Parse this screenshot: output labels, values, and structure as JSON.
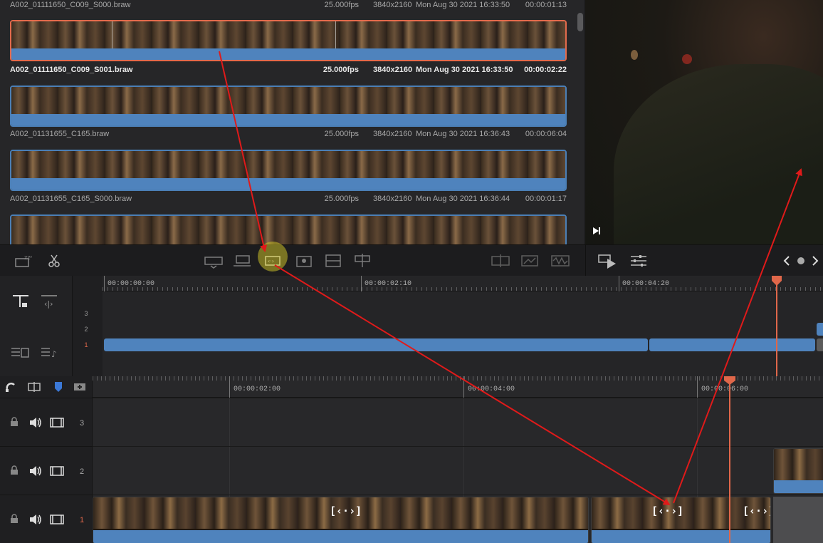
{
  "media_pool": {
    "clips": [
      {
        "name": "A002_01111650_C009_S000.braw",
        "fps": "25.000fps",
        "resolution": "3840x2160",
        "date": "Mon Aug 30 2021 16:33:50",
        "duration": "00:00:01:13"
      },
      {
        "name": "A002_01111650_C009_S001.braw",
        "fps": "25.000fps",
        "resolution": "3840x2160",
        "date": "Mon Aug 30 2021 16:33:50",
        "duration": "00:00:02:22"
      },
      {
        "name": "A002_01131655_C165.braw",
        "fps": "25.000fps",
        "resolution": "3840x2160",
        "date": "Mon Aug 30 2021 16:36:43",
        "duration": "00:00:06:04"
      },
      {
        "name": "A002_01131655_C165_S000.braw",
        "fps": "25.000fps",
        "resolution": "3840x2160",
        "date": "Mon Aug 30 2021 16:36:44",
        "duration": "00:00:01:17"
      }
    ]
  },
  "toolbar": {
    "icons": [
      "bypass-icon",
      "razor-icon",
      "smart-insert-icon",
      "append-icon",
      "ripple-overwrite-icon",
      "close-up-icon",
      "place-on-top-icon",
      "source-overwrite-icon",
      "split-clip-icon",
      "audio-only-icon",
      "video-only-icon",
      "waveform-icon",
      "playback-icon",
      "settings-sliders-icon"
    ]
  },
  "upper_timeline": {
    "ruler": [
      "00:00:00:00",
      "00:00:02:10",
      "00:00:04:20"
    ],
    "tracks": [
      "3",
      "2",
      "1"
    ]
  },
  "lower_timeline": {
    "ruler": [
      "00:00:02:00",
      "00:00:04:00",
      "00:00:06:00"
    ],
    "tracks": [
      "3",
      "2",
      "1"
    ],
    "transition_glyph": "[‹·›]"
  },
  "colors": {
    "accent_blue": "#4f83bd",
    "playhead": "#e0674a",
    "selection": "#e36a4c",
    "annotation_arrow": "#e01a1a"
  }
}
